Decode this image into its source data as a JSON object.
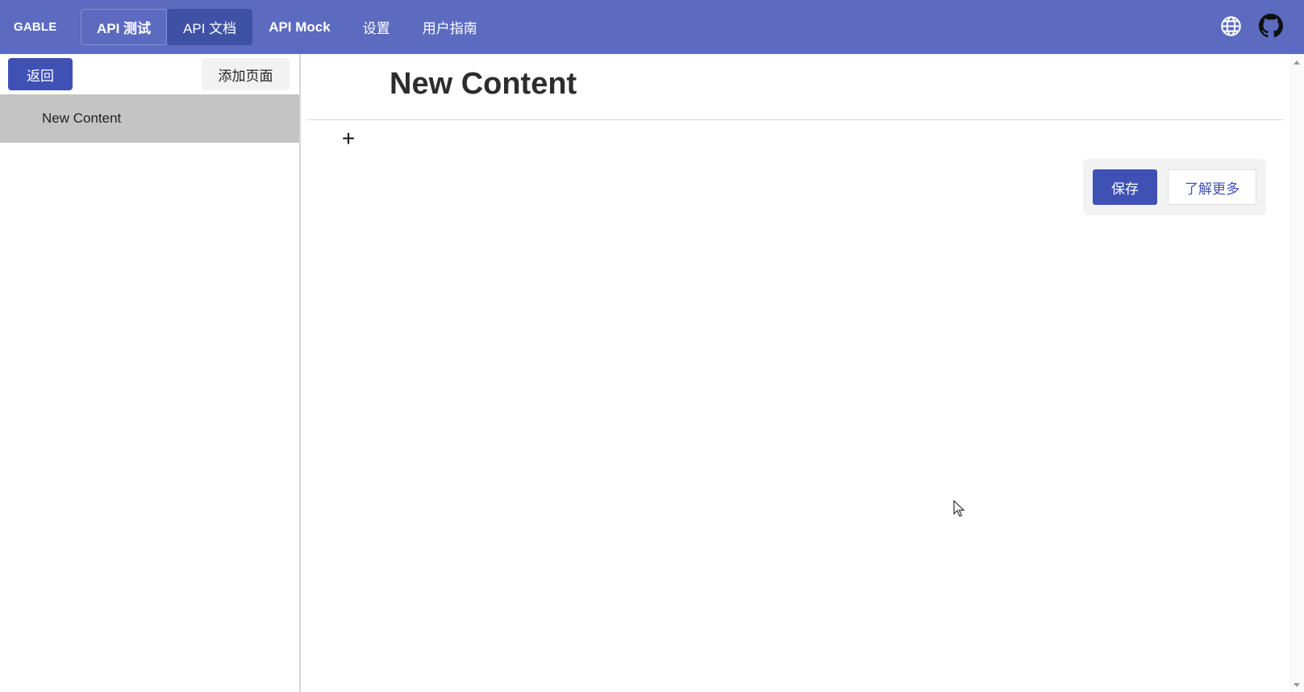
{
  "header": {
    "brand": "GABLE",
    "nav": [
      {
        "label": "API 测试"
      },
      {
        "label": "API 文档"
      },
      {
        "label": "API Mock"
      },
      {
        "label": "设置"
      },
      {
        "label": "用户指南"
      }
    ],
    "icons": [
      "globe-icon",
      "github-icon"
    ]
  },
  "sidebar": {
    "back_label": "返回",
    "add_page_label": "添加页面",
    "pages": [
      {
        "label": "New Content"
      }
    ]
  },
  "main": {
    "title": "New Content",
    "add_block_symbol": "+",
    "save_label": "保存",
    "learn_more_label": "了解更多"
  },
  "colors": {
    "header_bg": "#5c6bc0",
    "primary": "#3f51b5",
    "selected_item_bg": "#c4c4c4"
  }
}
